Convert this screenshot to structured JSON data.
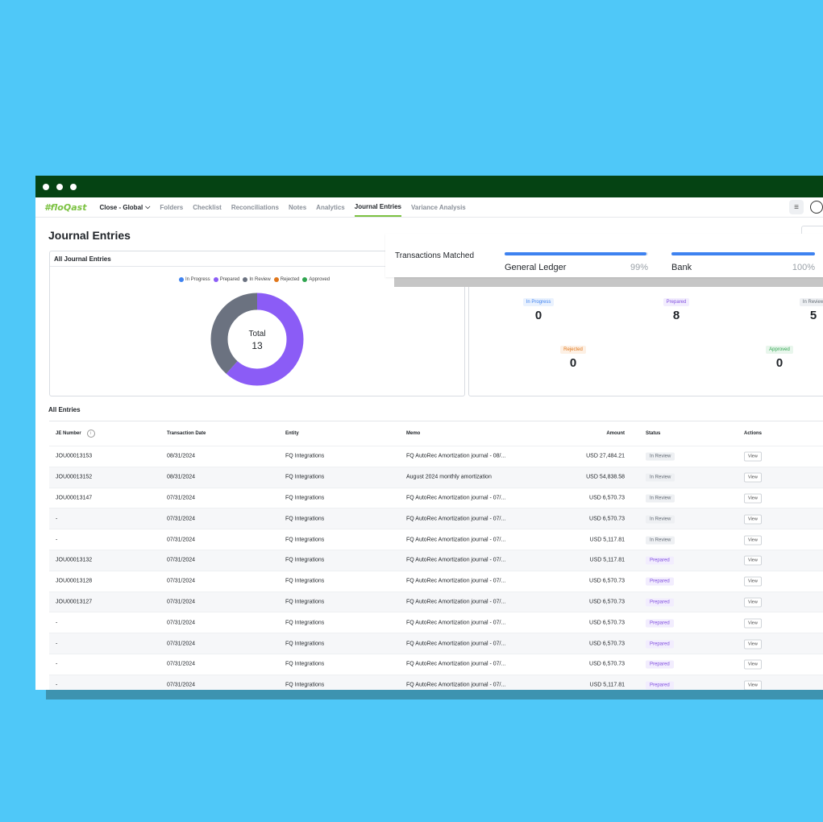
{
  "nav": {
    "logo": "#floQast",
    "close_select": "Close - Global",
    "items": [
      "Folders",
      "Checklist",
      "Reconciliations",
      "Notes",
      "Analytics",
      "Journal Entries",
      "Variance Analysis"
    ],
    "active": "Journal Entries"
  },
  "page": {
    "title": "Journal Entries"
  },
  "overview_card": {
    "title": "All Journal Entries",
    "legend": [
      "In Progress",
      "Prepared",
      "In Review",
      "Rejected",
      "Approved"
    ],
    "legend_colors": [
      "#3e82f0",
      "#8b5cf6",
      "#6b7280",
      "#e0761a",
      "#2fa44f"
    ],
    "total_label": "Total",
    "total_value": "13"
  },
  "chart_data": {
    "type": "pie",
    "categories": [
      "In Progress",
      "Prepared",
      "In Review",
      "Rejected",
      "Approved"
    ],
    "values": [
      0,
      8,
      5,
      0,
      0
    ],
    "colors": [
      "#3e82f0",
      "#8b5cf6",
      "#6b7280",
      "#e0761a",
      "#2fa44f"
    ]
  },
  "stats": {
    "in_progress": {
      "label": "In Progress",
      "value": "0"
    },
    "prepared": {
      "label": "Prepared",
      "value": "8"
    },
    "in_review": {
      "label": "In Review",
      "value": "5"
    },
    "rejected": {
      "label": "Rejected",
      "value": "0"
    },
    "approved": {
      "label": "Approved",
      "value": "0"
    }
  },
  "overlay": {
    "title": "Transactions Matched",
    "general_ledger": {
      "label": "General Ledger",
      "pct": "99%",
      "fill": 0.99
    },
    "bank": {
      "label": "Bank",
      "pct": "100%",
      "fill": 1.0
    }
  },
  "table": {
    "title": "All Entries",
    "headers": [
      "JE Number",
      "Transaction Date",
      "Entity",
      "Memo",
      "Amount",
      "Status",
      "Actions"
    ],
    "view_label": "View",
    "rows": [
      [
        "JOU00013153",
        "08/31/2024",
        "FQ Integrations",
        "FQ AutoRec Amortization journal - 08/...",
        "USD 27,484.21",
        "In Review"
      ],
      [
        "JOU00013152",
        "08/31/2024",
        "FQ Integrations",
        "August 2024 monthly amortization",
        "USD 54,838.58",
        "In Review"
      ],
      [
        "JOU00013147",
        "07/31/2024",
        "FQ Integrations",
        "FQ AutoRec Amortization journal - 07/...",
        "USD 6,570.73",
        "In Review"
      ],
      [
        "-",
        "07/31/2024",
        "FQ Integrations",
        "FQ AutoRec Amortization journal - 07/...",
        "USD 6,570.73",
        "In Review"
      ],
      [
        "-",
        "07/31/2024",
        "FQ Integrations",
        "FQ AutoRec Amortization journal - 07/...",
        "USD 5,117.81",
        "In Review"
      ],
      [
        "JOU00013132",
        "07/31/2024",
        "FQ Integrations",
        "FQ AutoRec Amortization journal - 07/...",
        "USD 5,117.81",
        "Prepared"
      ],
      [
        "JOU00013128",
        "07/31/2024",
        "FQ Integrations",
        "FQ AutoRec Amortization journal - 07/...",
        "USD 6,570.73",
        "Prepared"
      ],
      [
        "JOU00013127",
        "07/31/2024",
        "FQ Integrations",
        "FQ AutoRec Amortization journal - 07/...",
        "USD 6,570.73",
        "Prepared"
      ],
      [
        "-",
        "07/31/2024",
        "FQ Integrations",
        "FQ AutoRec Amortization journal - 07/...",
        "USD 6,570.73",
        "Prepared"
      ],
      [
        "-",
        "07/31/2024",
        "FQ Integrations",
        "FQ AutoRec Amortization journal - 07/...",
        "USD 6,570.73",
        "Prepared"
      ],
      [
        "-",
        "07/31/2024",
        "FQ Integrations",
        "FQ AutoRec Amortization journal - 07/...",
        "USD 6,570.73",
        "Prepared"
      ],
      [
        "-",
        "07/31/2024",
        "FQ Integrations",
        "FQ AutoRec Amortization journal - 07/...",
        "USD 5,117.81",
        "Prepared"
      ]
    ]
  }
}
